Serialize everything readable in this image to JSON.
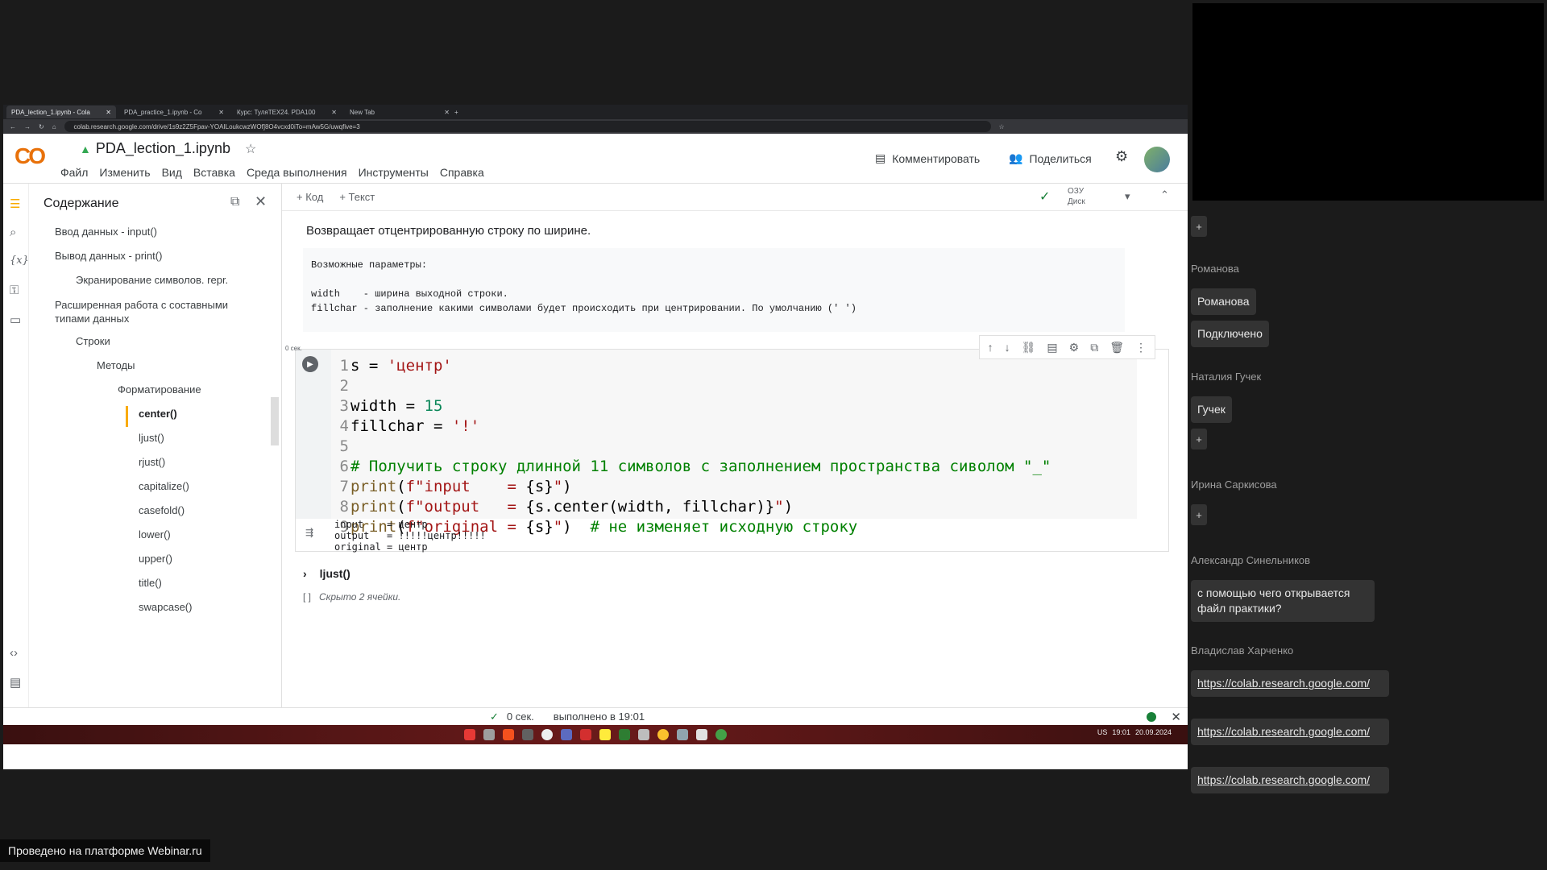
{
  "browser": {
    "tabs": [
      {
        "label": "PDA_lection_1.ipynb - Cola"
      },
      {
        "label": "PDA_practice_1.ipynb - Co"
      },
      {
        "label": "Курс: ТуляТЕХ24. PDA100"
      },
      {
        "label": "New Tab"
      }
    ],
    "url": "colab.research.google.com/drive/1s9z2Z5Fpav-YOAILoukcwzWOf]8O4vcxd0iTo=mAw5G/uwqfive=3"
  },
  "colab": {
    "logo": "CO",
    "notebook_title": "PDA_lection_1.ipynb",
    "menu": [
      "Файл",
      "Изменить",
      "Вид",
      "Вставка",
      "Среда выполнения",
      "Инструменты",
      "Справка"
    ],
    "comment_label": "Комментировать",
    "share_label": "Поделиться",
    "add_code": "+ Код",
    "add_text": "+ Текст",
    "ram_label": "ОЗУ",
    "disk_label": "Диск"
  },
  "toc": {
    "title": "Содержание",
    "items": [
      "Ввод данных - input()",
      "Вывод данных - print()",
      "Экранирование символов. repr.",
      "Расширенная работа с составными типами данных",
      "Строки",
      "Методы",
      "Форматирование",
      "center()",
      "ljust()",
      "rjust()",
      "capitalize()",
      "casefold()",
      "lower()",
      "upper()",
      "title()",
      "swapcase()"
    ]
  },
  "notebook": {
    "text_cell": "Возвращает отцентрированную строку по ширине.",
    "params": "Возможные параметры:\n\nwidth    - ширина выходной строки.\nfillchar - заполнение какими символами будет происходить при центрировании. По умолчанию (' ')",
    "exec_time": "0 сек.",
    "output": "input    = центр\noutput   = !!!!!центр!!!!!\noriginal = центр",
    "collapsed_section": "ljust()",
    "hidden_cells": "Скрыто 2 ячейки."
  },
  "status": {
    "check": "✓",
    "time": "0 сек.",
    "completed": "выполнено в 19:01"
  },
  "taskbar": {
    "lang": "US",
    "time": "19:01",
    "date": "20.09.2024"
  },
  "chat": {
    "entries": [
      {
        "name": "Романова",
        "messages": [
          "Романова",
          "Подключено"
        ]
      },
      {
        "name": "Наталия Гучек",
        "messages": [
          "Гучек"
        ]
      },
      {
        "name": "Ирина Саркисова",
        "messages": []
      },
      {
        "name": "Александр Синельников",
        "messages": [
          "с помощью чего открывается файл практики?"
        ]
      },
      {
        "name": "Владислав Харченко",
        "messages": [
          "https://colab.research.google.com/",
          "https://colab.research.google.com/",
          "https://colab.research.google.com/"
        ]
      }
    ],
    "plus": "+"
  },
  "footer": "Проведено на платформе Webinar.ru"
}
